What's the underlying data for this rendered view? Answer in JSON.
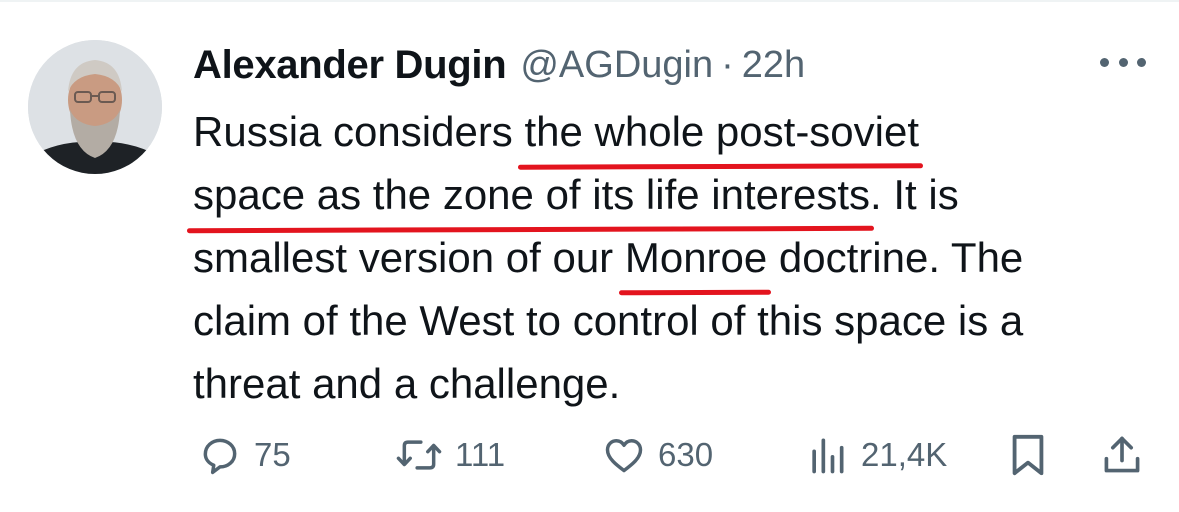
{
  "tweet": {
    "author_name": "Alexander Dugin",
    "handle": "@AGDugin",
    "separator": "·",
    "time": "22h",
    "lines": [
      {
        "pre": "Russia considers ",
        "ul": "the whole post-soviet",
        "post": ""
      },
      {
        "pre": "",
        "ul": "space as the zone of its life interests",
        "post": ". It is"
      },
      {
        "pre": "smallest version of our ",
        "ul": "Monroe",
        "post": " doctrine. The"
      },
      {
        "pre": "claim of the West to control of this space is a",
        "ul": "",
        "post": ""
      },
      {
        "pre": "threat and a challenge.",
        "ul": "",
        "post": ""
      }
    ]
  },
  "stats": {
    "replies": "75",
    "retweets": "111",
    "likes": "630",
    "views": "21,4K"
  },
  "icons": {
    "reply": "reply-icon",
    "retweet": "retweet-icon",
    "like": "heart-icon",
    "views": "views-icon",
    "bookmark": "bookmark-icon",
    "share": "share-icon",
    "more": "more-icon"
  },
  "colors": {
    "underline": "#e3141e",
    "text": "#0f1419",
    "secondary": "#536471"
  }
}
